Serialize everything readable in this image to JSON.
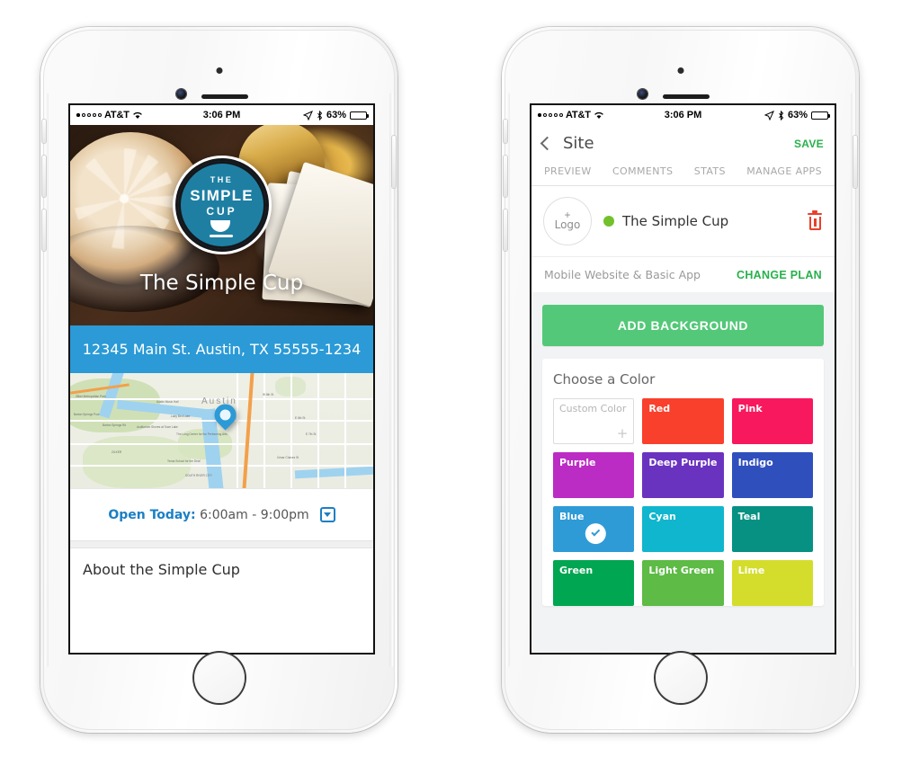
{
  "status_bar": {
    "carrier": "AT&T",
    "time": "3:06 PM",
    "battery": "63%",
    "signal_dots_filled": 1,
    "signal_dots_total": 5
  },
  "left_phone": {
    "hero": {
      "badge_line1": "THE",
      "badge_line2": "SIMPLE",
      "badge_line3": "CUP",
      "badge_icon": "coffee-cup-icon",
      "title": "The Simple Cup"
    },
    "address": "12345 Main St. Austin, TX 55555-1234",
    "map": {
      "pin": "location-pin-icon",
      "city_label": "Austin",
      "labels": [
        "Zilker Metropolitan Park",
        "Austin Music Hall",
        "Barton Springs Pool",
        "Auditorium Shores at Town Lake",
        "The Long Center for the Performing Arts",
        "Texas School for the Deaf",
        "ZILKER",
        "SOUTH RIVER CITY",
        "Lady Bird Lake",
        "Barton Springs Rd",
        "W 6th St",
        "E 6th St",
        "E 7th St",
        "Cesar Chavez St"
      ]
    },
    "hours": {
      "label": "Open Today:",
      "value": "6:00am - 9:00pm",
      "caret_icon": "chevron-down-icon"
    },
    "about_heading": "About the Simple Cup"
  },
  "right_phone": {
    "nav": {
      "back_icon": "chevron-left-icon",
      "title": "Site",
      "save_label": "SAVE"
    },
    "tabs": [
      {
        "label": "PREVIEW"
      },
      {
        "label": "COMMENTS"
      },
      {
        "label": "STATS"
      },
      {
        "label": "MANAGE APPS"
      }
    ],
    "site_card": {
      "logo_plus": "+",
      "logo_label": "Logo",
      "status_dot_color": "#72c02c",
      "site_name": "The Simple Cup",
      "delete_icon": "trash-icon",
      "plan_label": "Mobile Website & Basic App",
      "change_plan_label": "CHANGE PLAN"
    },
    "add_background_label": "ADD BACKGROUND",
    "color_picker": {
      "heading": "Choose a Color",
      "swatches": [
        {
          "label": "Custom Color",
          "color": "#ffffff",
          "custom": true,
          "selected": false
        },
        {
          "label": "Red",
          "color": "#f8402c",
          "custom": false,
          "selected": false
        },
        {
          "label": "Pink",
          "color": "#f8185e",
          "custom": false,
          "selected": false
        },
        {
          "label": "Purple",
          "color": "#bb2cc4",
          "custom": false,
          "selected": false
        },
        {
          "label": "Deep Purple",
          "color": "#6a33bf",
          "custom": false,
          "selected": false
        },
        {
          "label": "Indigo",
          "color": "#2f4fbd",
          "custom": false,
          "selected": false
        },
        {
          "label": "Blue",
          "color": "#2e9bd6",
          "custom": false,
          "selected": true
        },
        {
          "label": "Cyan",
          "color": "#10b6cd",
          "custom": false,
          "selected": false
        },
        {
          "label": "Teal",
          "color": "#069183",
          "custom": false,
          "selected": false
        },
        {
          "label": "Green",
          "color": "#00a651",
          "custom": false,
          "selected": false
        },
        {
          "label": "Light Green",
          "color": "#5dbb46",
          "custom": false,
          "selected": false
        },
        {
          "label": "Lime",
          "color": "#d4dd2c",
          "custom": false,
          "selected": false
        }
      ]
    }
  }
}
